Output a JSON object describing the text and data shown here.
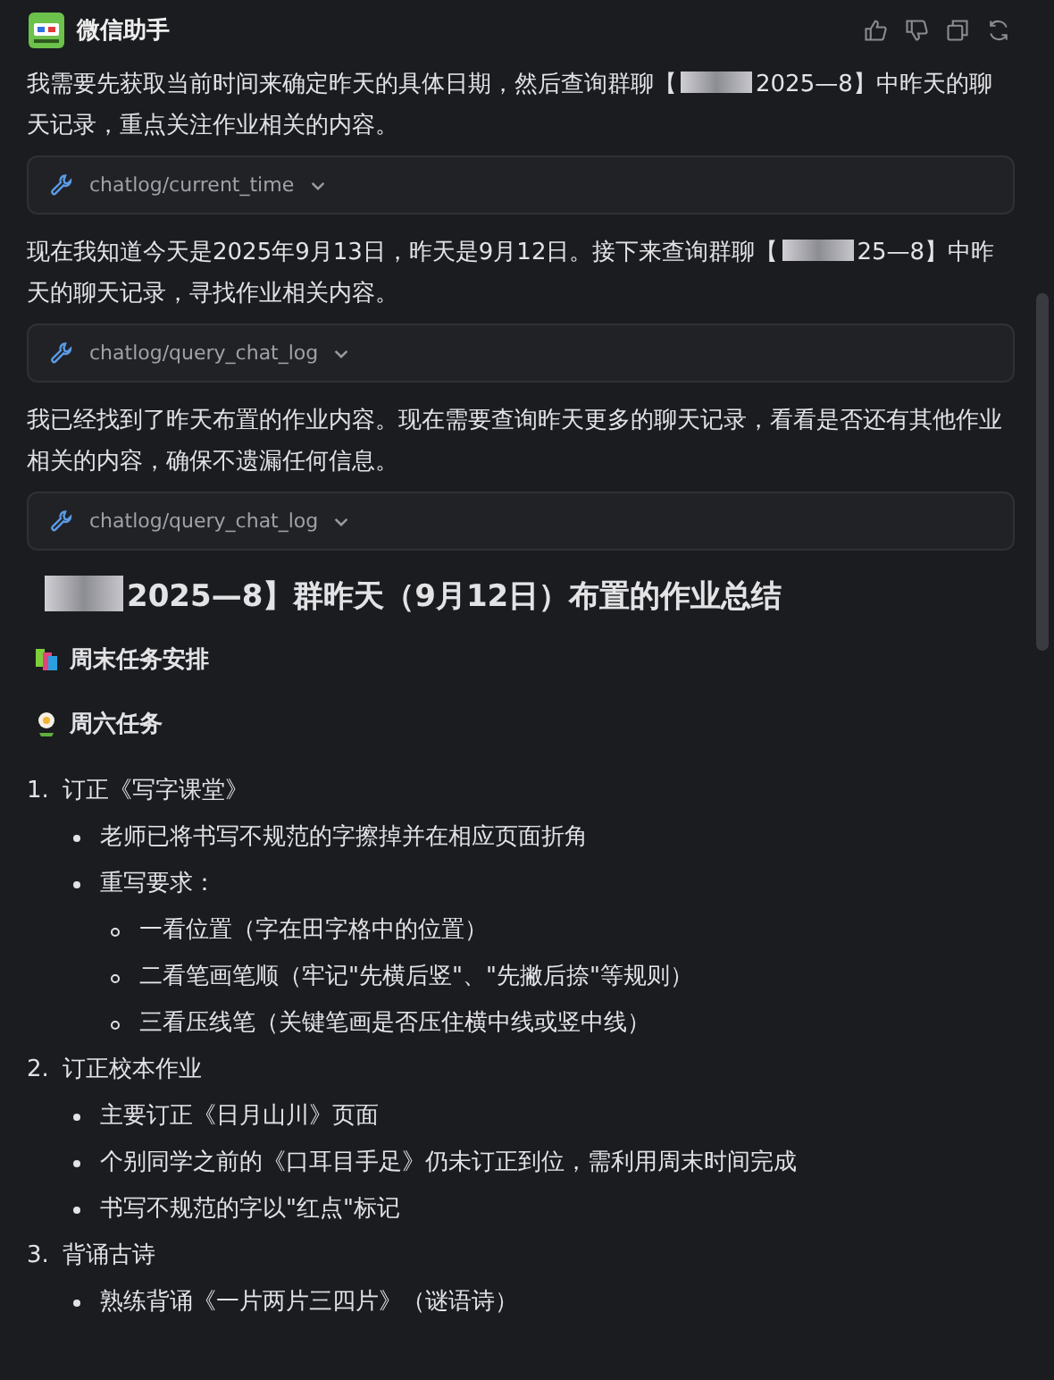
{
  "header": {
    "title": "微信助手"
  },
  "messages": [
    {
      "kind": "text",
      "before": "我需要先获取当前时间来确定昨天的具体日期，然后查询群聊【",
      "redacted": true,
      "after": "2025—8】中昨天的聊天记录，重点关注作业相关的内容。"
    },
    {
      "kind": "tool",
      "label": "chatlog/current_time",
      "expanded": false
    },
    {
      "kind": "text",
      "before": "现在我知道今天是2025年9月13日，昨天是9月12日。接下来查询群聊【",
      "redacted": true,
      "after": "25—8】中昨天的聊天记录，寻找作业相关内容。"
    },
    {
      "kind": "tool",
      "label": "chatlog/query_chat_log",
      "expanded": false
    },
    {
      "kind": "text",
      "before": "我已经找到了昨天布置的作业内容。现在需要查询昨天更多的聊天记录，看看是否还有其他作业相关的内容，确保不遗漏任何信息。",
      "redacted": false
    },
    {
      "kind": "tool",
      "label": "chatlog/query_chat_log",
      "expanded": false
    }
  ],
  "summary": {
    "title": {
      "redacted": true,
      "text": "2025—8】群昨天（9月12日）布置的作业总结"
    },
    "sections": [
      {
        "kind": "books",
        "title": "周末任务安排"
      },
      {
        "kind": "flower",
        "title": "周六任务"
      }
    ],
    "items": [
      {
        "number": "1.",
        "text": "订正《写字课堂》",
        "children": [
          {
            "text": "老师已将书写不规范的字擦掉并在相应页面折角"
          },
          {
            "text": "重写要求：",
            "children": [
              {
                "text": "一看位置（字在田字格中的位置）"
              },
              {
                "text": "二看笔画笔顺（牢记\"先横后竖\"、\"先撇后捺\"等规则）"
              },
              {
                "text": "三看压线笔（关键笔画是否压住横中线或竖中线）"
              }
            ]
          }
        ]
      },
      {
        "number": "2.",
        "text": "订正校本作业",
        "children": [
          {
            "text": "主要订正《日月山川》页面"
          },
          {
            "text": "个别同学之前的《口耳目手足》仍未订正到位，需利用周末时间完成"
          },
          {
            "text": "书写不规范的字以\"红点\"标记"
          }
        ]
      },
      {
        "number": "3.",
        "text": "背诵古诗",
        "children": [
          {
            "text": "熟练背诵《一片两片三四片》（谜语诗）"
          }
        ]
      }
    ]
  }
}
